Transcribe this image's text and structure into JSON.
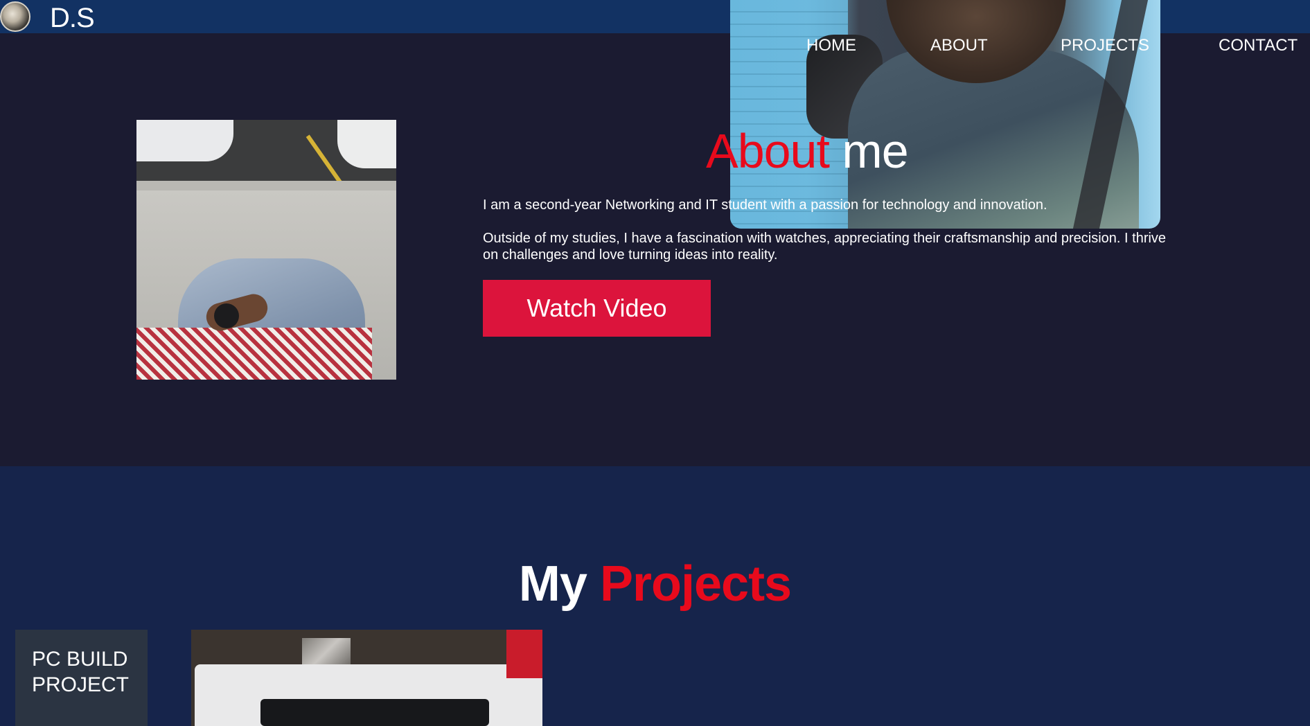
{
  "brand": {
    "logo_text": "D.S",
    "avatar_icon": "profile-avatar"
  },
  "nav": {
    "home": "HOME",
    "about": "ABOUT",
    "projects": "PROJECTS",
    "contact": "CONTACT"
  },
  "about": {
    "title_accent": "About",
    "title_rest": "me",
    "paragraph1": "I am a second-year Networking and IT student with a passion for technology and innovation.",
    "paragraph2": "Outside of my studies, I have a fascination with watches, appreciating their craftsmanship and precision. I thrive on challenges and love turning ideas into reality.",
    "button_label": "Watch Video"
  },
  "projects": {
    "title_rest": "My",
    "title_accent": "Projects",
    "items": [
      {
        "label": "PC BUILD PROJECT"
      }
    ]
  },
  "colors": {
    "topbar": "#123263",
    "hero_bg": "#1b1b31",
    "projects_bg": "#16244b",
    "accent": "#e80a1c",
    "button": "#dc143c",
    "card": "#2b3442"
  }
}
